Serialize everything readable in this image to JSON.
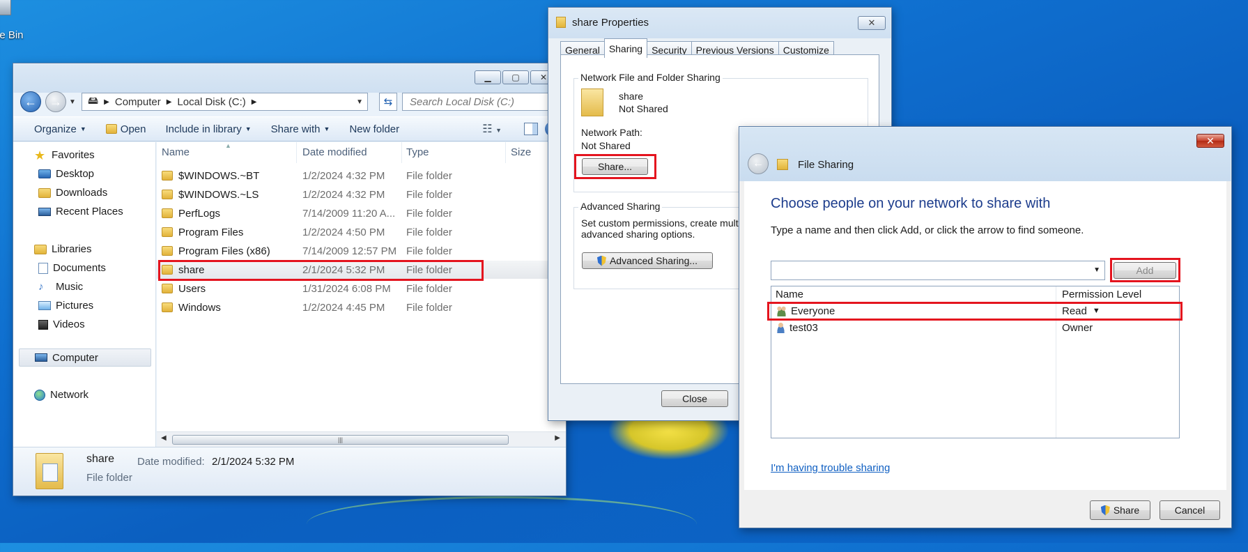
{
  "desktop": {
    "recycle_bin_label": "le Bin"
  },
  "explorer": {
    "address": {
      "segments": [
        "Computer",
        "Local Disk (C:)"
      ]
    },
    "search_placeholder": "Search Local Disk (C:)",
    "toolbar": {
      "organize": "Organize",
      "open": "Open",
      "include_in_library": "Include in library",
      "share_with": "Share with",
      "new_folder": "New folder"
    },
    "nav": {
      "favorites": "Favorites",
      "desktop": "Desktop",
      "downloads": "Downloads",
      "recent_places": "Recent Places",
      "libraries": "Libraries",
      "documents": "Documents",
      "music": "Music",
      "pictures": "Pictures",
      "videos": "Videos",
      "computer": "Computer",
      "network": "Network"
    },
    "columns": {
      "name": "Name",
      "date_modified": "Date modified",
      "type": "Type",
      "size": "Size"
    },
    "files": [
      {
        "name": "$WINDOWS.~BT",
        "date": "1/2/2024 4:32 PM",
        "type": "File folder"
      },
      {
        "name": "$WINDOWS.~LS",
        "date": "1/2/2024 4:32 PM",
        "type": "File folder"
      },
      {
        "name": "PerfLogs",
        "date": "7/14/2009 11:20 A...",
        "type": "File folder"
      },
      {
        "name": "Program Files",
        "date": "1/2/2024 4:50 PM",
        "type": "File folder"
      },
      {
        "name": "Program Files (x86)",
        "date": "7/14/2009 12:57 PM",
        "type": "File folder"
      },
      {
        "name": "share",
        "date": "2/1/2024 5:32 PM",
        "type": "File folder"
      },
      {
        "name": "Users",
        "date": "1/31/2024 6:08 PM",
        "type": "File folder"
      },
      {
        "name": "Windows",
        "date": "1/2/2024 4:45 PM",
        "type": "File folder"
      }
    ],
    "details": {
      "name": "share",
      "modified_label": "Date modified:",
      "modified_value": "2/1/2024 5:32 PM",
      "kind": "File folder"
    }
  },
  "properties": {
    "title": "share Properties",
    "tabs": [
      "General",
      "Sharing",
      "Security",
      "Previous Versions",
      "Customize"
    ],
    "active_tab": "Sharing",
    "network_sharing": {
      "group_label": "Network File and Folder Sharing",
      "folder_name": "share",
      "status": "Not Shared",
      "path_label": "Network Path:",
      "path_value": "Not Shared",
      "share_button": "Share..."
    },
    "advanced_sharing": {
      "group_label": "Advanced Sharing",
      "description_line1": "Set custom permissions, create multipl",
      "description_line2": "advanced sharing options.",
      "button": "Advanced Sharing..."
    },
    "close_button": "Close"
  },
  "file_sharing": {
    "title": "File Sharing",
    "heading": "Choose people on your network to share with",
    "instruction": "Type a name and then click Add, or click the arrow to find someone.",
    "input_value": "",
    "add_button": "Add",
    "columns": {
      "name": "Name",
      "permission": "Permission Level"
    },
    "people": [
      {
        "name": "Everyone",
        "permission": "Read",
        "icon": "group-icon"
      },
      {
        "name": "test03",
        "permission": "Owner",
        "icon": "user-icon"
      }
    ],
    "trouble_link": "I'm having trouble sharing",
    "share_button": "Share",
    "cancel_button": "Cancel"
  },
  "colors": {
    "highlight": "#e4141e",
    "heading_blue": "#1c3c8c",
    "link_blue": "#0f5fc2"
  }
}
